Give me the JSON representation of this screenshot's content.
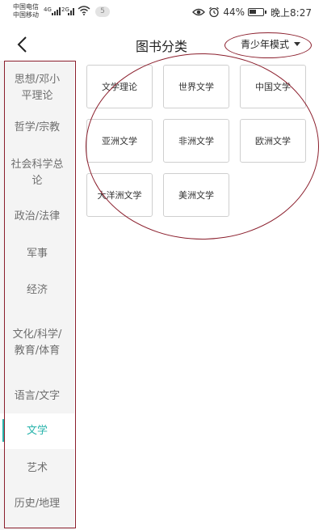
{
  "status_bar": {
    "carrier_1": "中国电信",
    "carrier_2": "中国移动",
    "network_1": "4G",
    "network_2": "2G",
    "notification_count": "5",
    "battery": "44%",
    "time": "晚上8:27"
  },
  "header": {
    "title": "图书分类",
    "mode_label": "青少年模式"
  },
  "sidebar": {
    "items": [
      {
        "label": "思想/邓小平理论",
        "active": false
      },
      {
        "label": "哲学/宗教",
        "active": false
      },
      {
        "label": "社会科学总论",
        "active": false
      },
      {
        "label": "政治/法律",
        "active": false
      },
      {
        "label": "军事",
        "active": false
      },
      {
        "label": "经济",
        "active": false
      },
      {
        "label": "文化/科学/教育/体育",
        "active": false
      },
      {
        "label": "语言/文字",
        "active": false
      },
      {
        "label": "文学",
        "active": true
      },
      {
        "label": "艺术",
        "active": false
      },
      {
        "label": "历史/地理",
        "active": false
      }
    ],
    "accent_color": "#27b3ab"
  },
  "categories": [
    {
      "label": "文学理论"
    },
    {
      "label": "世界文学"
    },
    {
      "label": "中国文学"
    },
    {
      "label": "亚洲文学"
    },
    {
      "label": "非洲文学"
    },
    {
      "label": "欧洲文学"
    },
    {
      "label": "大洋洲文学"
    },
    {
      "label": "美洲文学"
    }
  ],
  "annotation_color": "#8b1f2d"
}
